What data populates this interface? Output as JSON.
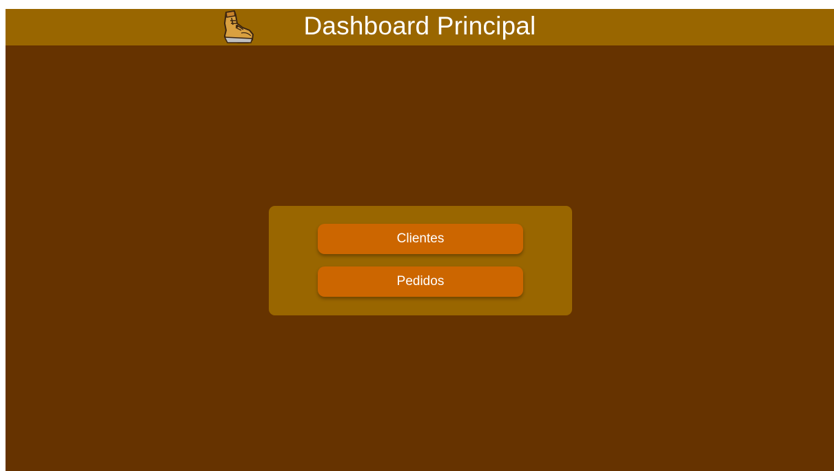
{
  "header": {
    "title": "Dashboard Principal",
    "logo_icon": "boot-icon"
  },
  "menu": {
    "items": [
      {
        "label": "Clientes"
      },
      {
        "label": "Pedidos"
      }
    ]
  },
  "colors": {
    "page_background": "#663300",
    "header_background": "#996600",
    "panel_background": "#996600",
    "button_background": "#cc6600",
    "text": "#ffffff"
  }
}
